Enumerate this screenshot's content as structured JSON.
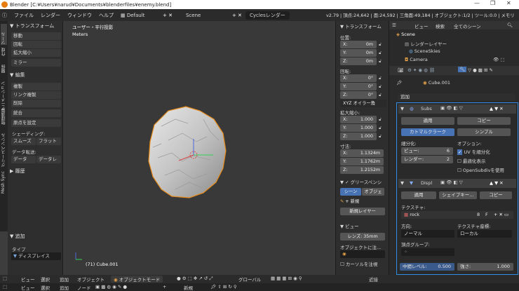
{
  "title_bar": {
    "text": "Blender [C:¥Users¥narud¥Documents¥blenderfiles¥enemy.blend]",
    "minimize": "—",
    "maximize": "❐",
    "close": "✕"
  },
  "top_menu": [
    "ファイル",
    "レンダー",
    "ウィンドウ",
    "ヘルプ"
  ],
  "workspace": "Default",
  "scene": "Scene",
  "renderer": "Cyclesレンダー",
  "stats": "v2.79 | 頂点:24,642 | 面:24,592 | 三角面:49,184 | オブジェクト:1/2 | ツール:0.0 | メモリ",
  "left_tabs": [
    "ツール",
    "作成",
    "関係",
    "アニメーション",
    "物理演算",
    "グリースペンシル",
    "Mesh Sync"
  ],
  "tool_panel": {
    "transform_header": "▼ トランスフォーム",
    "transform_buttons": [
      "移動",
      "回転",
      "拡大縮小",
      "ミラー"
    ],
    "edit_header": "▼ 編集",
    "edit_buttons": [
      "複製",
      "リンク複製",
      "削除",
      "統合",
      "原点を設定"
    ],
    "shading_label": "シェーディング:",
    "shading_buttons": [
      "スムーズ",
      "フラット"
    ],
    "data_transfer_label": "データ転送:",
    "data_transfer_buttons": [
      "データ",
      "データレ"
    ],
    "history_header": "▶ 履歴",
    "add_header": "▼ 追加",
    "type_label": "タイプ",
    "type_value": "ディスプレイス"
  },
  "viewport": {
    "view_label": "ユーザー・平行投影",
    "units": "Meters",
    "object_label": "(71) Cube.001"
  },
  "n_panel": {
    "transform_header": "▼ トランスフォーム",
    "location_label": "位置:",
    "location": [
      {
        "axis": "X:",
        "value": "0m"
      },
      {
        "axis": "Y:",
        "value": "0m"
      },
      {
        "axis": "Z:",
        "value": "0m"
      }
    ],
    "rotation_label": "回転:",
    "rotation": [
      {
        "axis": "X:",
        "value": "0°"
      },
      {
        "axis": "Y:",
        "value": "0°"
      },
      {
        "axis": "Z:",
        "value": "0°"
      }
    ],
    "euler": "XYZ オイラー角",
    "scale_label": "拡大縮小:",
    "scale": [
      {
        "axis": "X:",
        "value": "1.000"
      },
      {
        "axis": "Y:",
        "value": "1.000"
      },
      {
        "axis": "Z:",
        "value": "1.000"
      }
    ],
    "dimensions_label": "寸法:",
    "dimensions": [
      {
        "axis": "X:",
        "value": "1.1324m"
      },
      {
        "axis": "Y:",
        "value": "1.1762m"
      },
      {
        "axis": "Z:",
        "value": "1.2152m"
      }
    ],
    "grease_pencil_header": "▼ ✓ グリースペンシ",
    "gp_tabs": [
      "シーン",
      "オブジェ"
    ],
    "gp_new": "新規",
    "gp_new_layer": "新規レイヤー",
    "view_header": "▼ ビュー",
    "lens": "レンズ: 35mm",
    "lock_to_object": "オブジェクトに注...",
    "cursor_label": "カーソルを注視"
  },
  "outliner": {
    "menu": [
      "ビュー",
      "検索",
      "全てのシーン"
    ],
    "items": [
      "Scene",
      "レンダーレイヤー",
      "SceneSkies",
      "Camera"
    ]
  },
  "properties": {
    "object_name": "Cube.001",
    "add_modifier": "追加",
    "subsurf": {
      "name": "Subs",
      "apply": "適用",
      "copy": "コピー",
      "algo_tabs": [
        "カトマルクラーク",
        "シンプル"
      ],
      "subdivisions_label": "細分化:",
      "options_label": "オプション:",
      "view_label": "ビュー:",
      "view_value": "6",
      "render_label": "レンダー:",
      "render_value": "2",
      "uv_subdivide": "UV を細分化",
      "optimal_display": "最適化表示",
      "opensubdiv": "OpenSubdivを使用"
    },
    "displace": {
      "name": "Displ",
      "apply": "適用",
      "shape_key": "シェイプキー…",
      "copy": "コピー",
      "texture_label": "テクスチャ:",
      "texture_name": "rock",
      "texture_users": "8",
      "texture_f": "F",
      "direction_label": "方向:",
      "direction_value": "ノーマル",
      "coords_label": "テクスチャ座標:",
      "coords_value": "ローカル",
      "vgroup_label": "頂点グループ:",
      "midlevel_label": "中間レベル:",
      "midlevel_value": "0.500",
      "strength_label": "強さ:",
      "strength_value": "1.000"
    }
  },
  "header_bottom": {
    "items": [
      "ビュー",
      "選択",
      "追加",
      "オブジェクト"
    ],
    "mode": "オブジェクトモード",
    "pivot": "グローバル",
    "proximity": "近接"
  },
  "timeline_bottom": {
    "items": [
      "ビュー",
      "選択",
      "追加",
      "ノード"
    ],
    "new": "新規"
  },
  "colors": {
    "accent_orange": "#e87d0d",
    "selection_blue": "#4772b3",
    "modifier_highlight": "#2f8de4"
  }
}
